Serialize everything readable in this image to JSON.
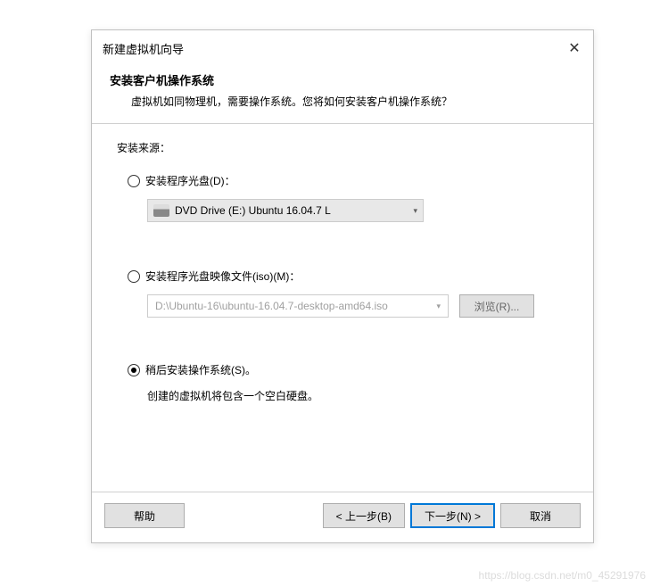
{
  "titlebar": {
    "title": "新建虚拟机向导"
  },
  "header": {
    "title": "安装客户机操作系统",
    "description": "虚拟机如同物理机，需要操作系统。您将如何安装客户机操作系统？"
  },
  "content": {
    "source_label": "安装来源：",
    "option_disc": {
      "label": "安装程序光盘(D)：",
      "dropdown_value": "DVD Drive (E:) Ubuntu 16.04.7 L"
    },
    "option_iso": {
      "label": "安装程序光盘映像文件(iso)(M)：",
      "path": "D:\\Ubuntu-16\\ubuntu-16.04.7-desktop-amd64.iso",
      "browse_label": "浏览(R)..."
    },
    "option_later": {
      "label": "稍后安装操作系统(S)。",
      "description": "创建的虚拟机将包含一个空白硬盘。"
    }
  },
  "footer": {
    "help": "帮助",
    "back": "< 上一步(B)",
    "next": "下一步(N) >",
    "cancel": "取消"
  },
  "watermark": "https://blog.csdn.net/m0_45291976"
}
